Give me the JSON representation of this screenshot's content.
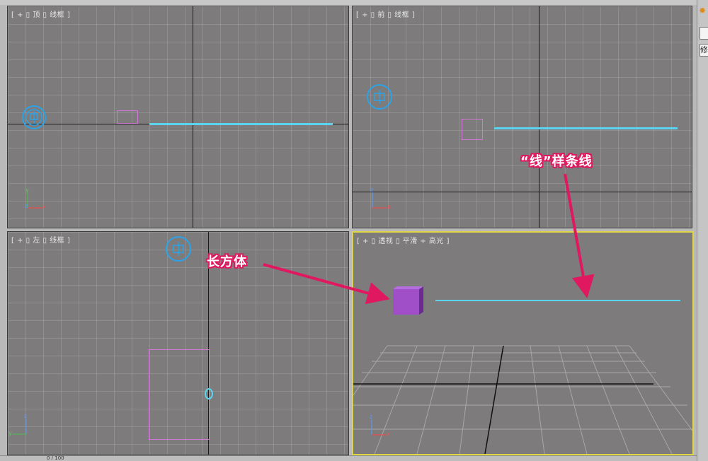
{
  "viewports": {
    "top": {
      "label": "[ + ▯ 顶 ▯ 线框 ]"
    },
    "front": {
      "label": "[ + ▯ 前 ▯ 线框 ]"
    },
    "left": {
      "label": "[ + ▯ 左 ▯ 线框 ]"
    },
    "perspective": {
      "label": "[ + ▯ 透视 ▯ 平滑 + 高光 ]"
    }
  },
  "axes": {
    "x": "x",
    "y": "y",
    "z": "z"
  },
  "annotations": {
    "box": "长方体",
    "spline": "“线”样条线"
  },
  "right_panel": {
    "tab_char": "修"
  },
  "status": {
    "frame_counter": "0 / 100"
  },
  "colors": {
    "viewport_bg": "#7d7b7c",
    "active_border": "#e1d544",
    "spline": "#5bd4f0",
    "box": "#a04fc8",
    "annotation": "#e0185f"
  }
}
